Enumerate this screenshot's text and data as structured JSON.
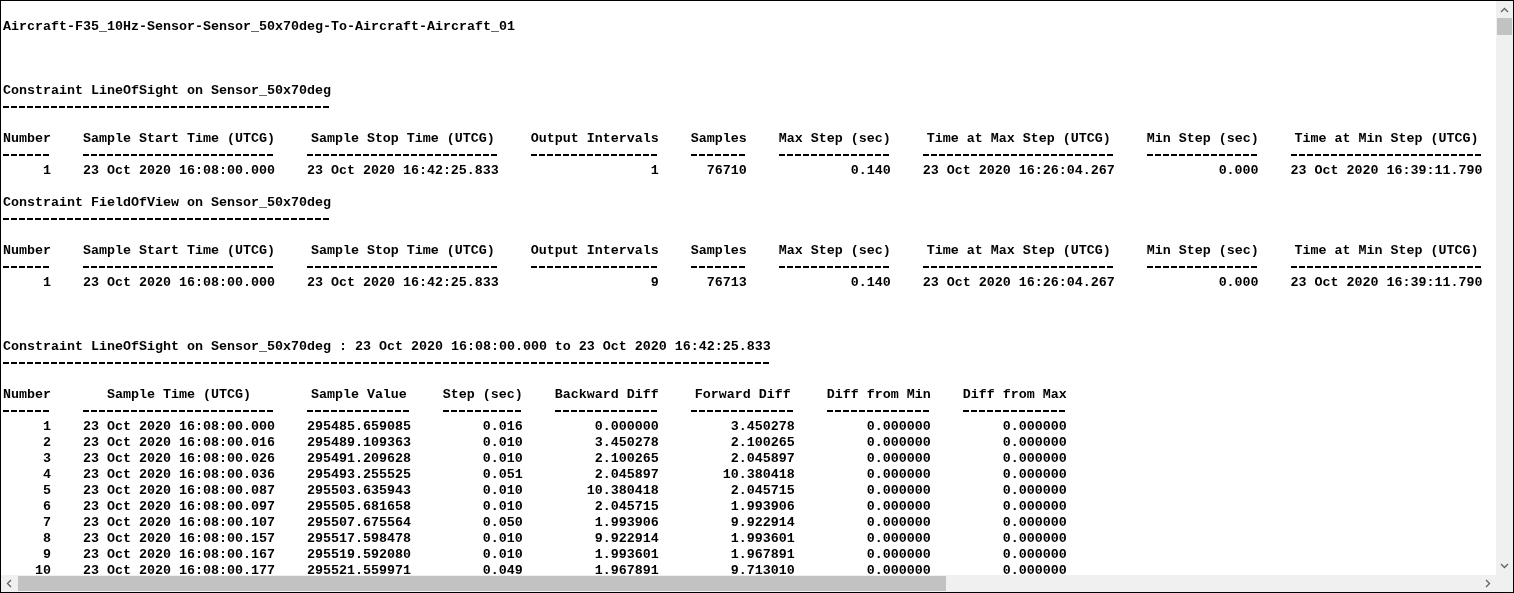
{
  "document": {
    "title": "Aircraft-F35_10Hz-Sensor-Sensor_50x70deg-To-Aircraft-Aircraft_01"
  },
  "sections": [
    {
      "kind": "summary",
      "title": "Constraint LineOfSight on Sensor_50x70deg",
      "columns": [
        "Number",
        "Sample Start Time (UTCG)",
        "Sample Stop Time (UTCG)",
        "Output Intervals",
        "Samples",
        "Max Step (sec)",
        "Time at Max Step (UTCG)",
        "Min Step (sec)",
        "Time at Min Step (UTCG)"
      ],
      "rows": [
        [
          "1",
          "23 Oct 2020 16:08:00.000",
          "23 Oct 2020 16:42:25.833",
          "1",
          "76710",
          "0.140",
          "23 Oct 2020 16:26:04.267",
          "0.000",
          "23 Oct 2020 16:39:11.790"
        ]
      ]
    },
    {
      "kind": "summary",
      "title": "Constraint FieldOfView on Sensor_50x70deg",
      "columns": [
        "Number",
        "Sample Start Time (UTCG)",
        "Sample Stop Time (UTCG)",
        "Output Intervals",
        "Samples",
        "Max Step (sec)",
        "Time at Max Step (UTCG)",
        "Min Step (sec)",
        "Time at Min Step (UTCG)"
      ],
      "rows": [
        [
          "1",
          "23 Oct 2020 16:08:00.000",
          "23 Oct 2020 16:42:25.833",
          "9",
          "76713",
          "0.140",
          "23 Oct 2020 16:26:04.267",
          "0.000",
          "23 Oct 2020 16:39:11.790"
        ]
      ]
    },
    {
      "kind": "samples",
      "title": "Constraint LineOfSight on Sensor_50x70deg : 23 Oct 2020 16:08:00.000 to 23 Oct 2020 16:42:25.833",
      "columns": [
        "Number",
        "Sample Time (UTCG)",
        "Sample Value",
        "Step (sec)",
        "Backward Diff",
        "Forward Diff",
        "Diff from Min",
        "Diff from Max"
      ],
      "rows": [
        [
          "1",
          "23 Oct 2020 16:08:00.000",
          "295485.659085",
          "0.016",
          "0.000000",
          "3.450278",
          "0.000000",
          "0.000000"
        ],
        [
          "2",
          "23 Oct 2020 16:08:00.016",
          "295489.109363",
          "0.010",
          "3.450278",
          "2.100265",
          "0.000000",
          "0.000000"
        ],
        [
          "3",
          "23 Oct 2020 16:08:00.026",
          "295491.209628",
          "0.010",
          "2.100265",
          "2.045897",
          "0.000000",
          "0.000000"
        ],
        [
          "4",
          "23 Oct 2020 16:08:00.036",
          "295493.255525",
          "0.051",
          "2.045897",
          "10.380418",
          "0.000000",
          "0.000000"
        ],
        [
          "5",
          "23 Oct 2020 16:08:00.087",
          "295503.635943",
          "0.010",
          "10.380418",
          "2.045715",
          "0.000000",
          "0.000000"
        ],
        [
          "6",
          "23 Oct 2020 16:08:00.097",
          "295505.681658",
          "0.010",
          "2.045715",
          "1.993906",
          "0.000000",
          "0.000000"
        ],
        [
          "7",
          "23 Oct 2020 16:08:00.107",
          "295507.675564",
          "0.050",
          "1.993906",
          "9.922914",
          "0.000000",
          "0.000000"
        ],
        [
          "8",
          "23 Oct 2020 16:08:00.157",
          "295517.598478",
          "0.010",
          "9.922914",
          "1.993601",
          "0.000000",
          "0.000000"
        ],
        [
          "9",
          "23 Oct 2020 16:08:00.167",
          "295519.592080",
          "0.010",
          "1.993601",
          "1.967891",
          "0.000000",
          "0.000000"
        ],
        [
          "10",
          "23 Oct 2020 16:08:00.177",
          "295521.559971",
          "0.049",
          "1.967891",
          "9.713010",
          "0.000000",
          "0.000000"
        ]
      ]
    }
  ]
}
